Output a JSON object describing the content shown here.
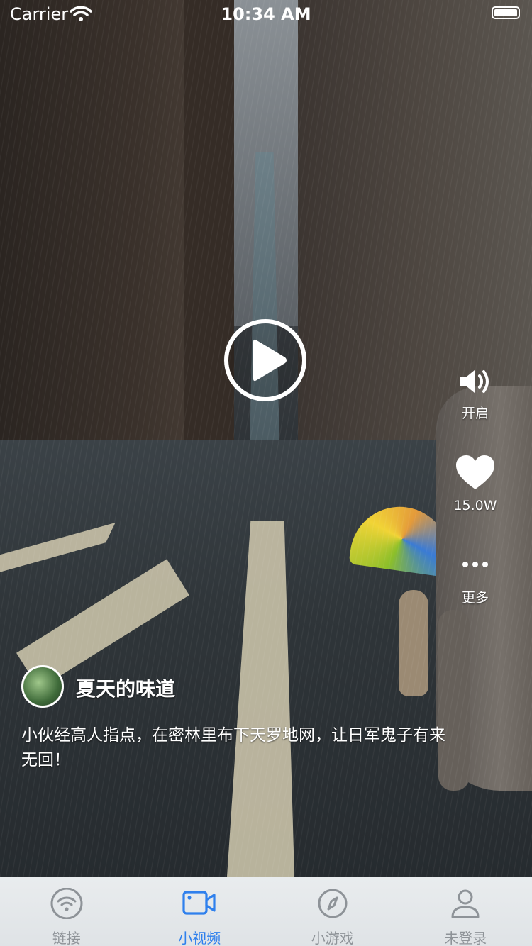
{
  "status_bar": {
    "carrier": "Carrier",
    "time": "10:34 AM"
  },
  "video": {
    "play_icon": "play-icon",
    "actions": {
      "sound": {
        "label": "开启",
        "icon": "speaker-icon"
      },
      "like": {
        "label": "15.0W",
        "icon": "heart-icon"
      },
      "more": {
        "label": "更多",
        "icon": "ellipsis-icon"
      }
    },
    "author": {
      "name": "夏天的味道"
    },
    "caption": "小伙经高人指点，在密林里布下天罗地网，让日军鬼子有来无回！"
  },
  "tabbar": {
    "active_color": "#2f80ed",
    "inactive_color": "#8e9398",
    "tabs": [
      {
        "label": "链接",
        "icon": "wifi-icon"
      },
      {
        "label": "小视频",
        "icon": "video-camera-icon"
      },
      {
        "label": "小游戏",
        "icon": "compass-icon"
      },
      {
        "label": "未登录",
        "icon": "user-icon"
      }
    ]
  }
}
